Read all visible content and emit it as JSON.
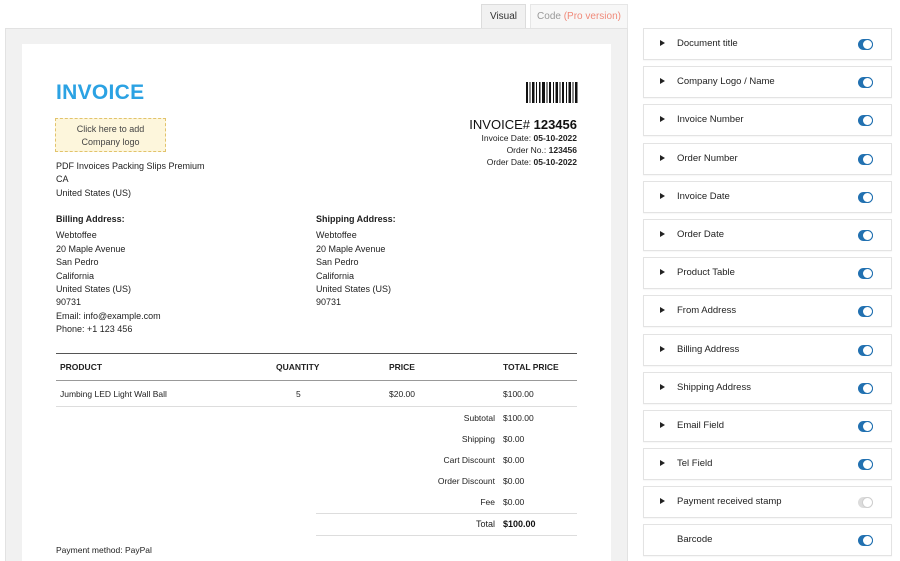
{
  "tabs": {
    "visual": "Visual",
    "code": "Code",
    "code_pro": "(Pro version)"
  },
  "invoice": {
    "title": "INVOICE",
    "logo_line1": "Click here to add",
    "logo_line2": "Company logo",
    "from_lines": [
      "PDF Invoices Packing Slips Premium",
      "CA",
      "United States (US)"
    ],
    "number_label": "INVOICE#",
    "number": "123456",
    "meta": [
      {
        "label": "Invoice Date:",
        "value": "05-10-2022"
      },
      {
        "label": "Order No.:",
        "value": "123456"
      },
      {
        "label": "Order Date:",
        "value": "05-10-2022"
      }
    ],
    "billing": {
      "heading": "Billing Address:",
      "lines": [
        "Webtoffee",
        "20 Maple Avenue",
        "San Pedro",
        "California",
        "United States (US)",
        "90731",
        "Email: info@example.com",
        "Phone: +1 123 456"
      ]
    },
    "shipping": {
      "heading": "Shipping Address:",
      "lines": [
        "Webtoffee",
        "20 Maple Avenue",
        "San Pedro",
        "California",
        "United States (US)",
        "90731"
      ]
    },
    "table": {
      "headers": [
        "PRODUCT",
        "QUANTITY",
        "PRICE",
        "TOTAL PRICE"
      ],
      "rows": [
        [
          "Jumbing LED Light Wall Ball",
          "5",
          "$20.00",
          "$100.00"
        ]
      ]
    },
    "summary": [
      {
        "label": "Subtotal",
        "value": "$100.00"
      },
      {
        "label": "Shipping",
        "value": "$0.00"
      },
      {
        "label": "Cart Discount",
        "value": "$0.00"
      },
      {
        "label": "Order Discount",
        "value": "$0.00"
      },
      {
        "label": "Fee",
        "value": "$0.00"
      }
    ],
    "total_label": "Total",
    "total_value": "$100.00",
    "payment_method": "Payment method: PayPal"
  },
  "panel": {
    "items": [
      {
        "label": "Document title",
        "on": true,
        "expandable": true
      },
      {
        "label": "Company Logo / Name",
        "on": true,
        "expandable": true
      },
      {
        "label": "Invoice Number",
        "on": true,
        "expandable": true
      },
      {
        "label": "Order Number",
        "on": true,
        "expandable": true
      },
      {
        "label": "Invoice Date",
        "on": true,
        "expandable": true
      },
      {
        "label": "Order Date",
        "on": true,
        "expandable": true
      },
      {
        "label": "Product Table",
        "on": true,
        "expandable": true
      },
      {
        "label": "From Address",
        "on": true,
        "expandable": true
      },
      {
        "label": "Billing Address",
        "on": true,
        "expandable": true
      },
      {
        "label": "Shipping Address",
        "on": true,
        "expandable": true
      },
      {
        "label": "Email Field",
        "on": true,
        "expandable": true
      },
      {
        "label": "Tel Field",
        "on": true,
        "expandable": true
      },
      {
        "label": "Payment received stamp",
        "on": false,
        "expandable": true
      },
      {
        "label": "Barcode",
        "on": true,
        "expandable": false
      }
    ]
  },
  "colors": {
    "accent": "#2ba2e3",
    "toggle_on": "#2271b1",
    "pro": "#f08a7a"
  }
}
